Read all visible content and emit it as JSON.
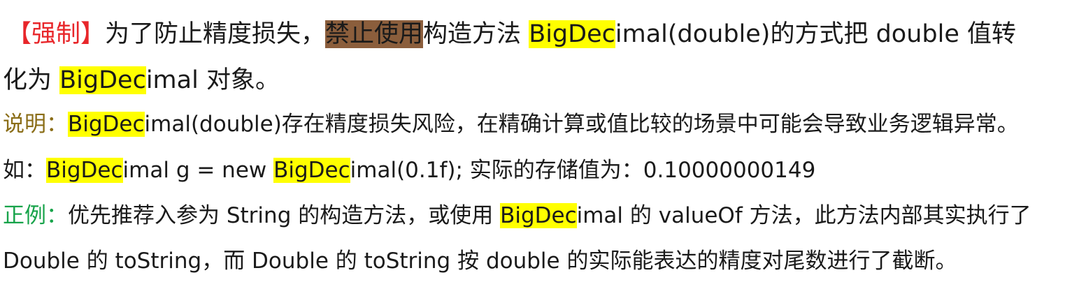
{
  "rule": {
    "tag": "【强制】",
    "part1": "为了防止精度损失，",
    "highlight_forbid": "禁止使用",
    "part2": "构造方法 ",
    "bd_hl": "BigDec",
    "bd_rest": "imal(double)的方式把 double 值转",
    "part3": "化为 ",
    "bd2_hl": "BigDec",
    "bd2_rest": "imal 对象。"
  },
  "explain": {
    "label": "说明：",
    "bd_hl": "BigDec",
    "text": "imal(double)存在精度损失风险，在精确计算或值比较的场景中可能会导致业务逻辑异常。"
  },
  "example": {
    "lead": "如：",
    "bd1_hl": "BigDec",
    "part1": "imal g = new ",
    "bd2_hl": "BigDec",
    "part2": "imal(0.1f);  实际的存储值为：0.10000000149"
  },
  "positive": {
    "label": "正例：",
    "text1": "优先推荐入参为 String 的构造方法，或使用 ",
    "bd_hl": "BigDec",
    "text2": "imal 的 valueOf 方法，此方法内部其实执行了",
    "line2": "Double 的 toString，而 Double 的 toString 按 double 的实际能表达的精度对尾数进行了截断。"
  },
  "colors": {
    "tag_red": "#e8262a",
    "label_olive": "#8a6d17",
    "label_green": "#17a34a",
    "highlight_yellow": "#ffff00",
    "highlight_brown": "#8b5e3c"
  }
}
